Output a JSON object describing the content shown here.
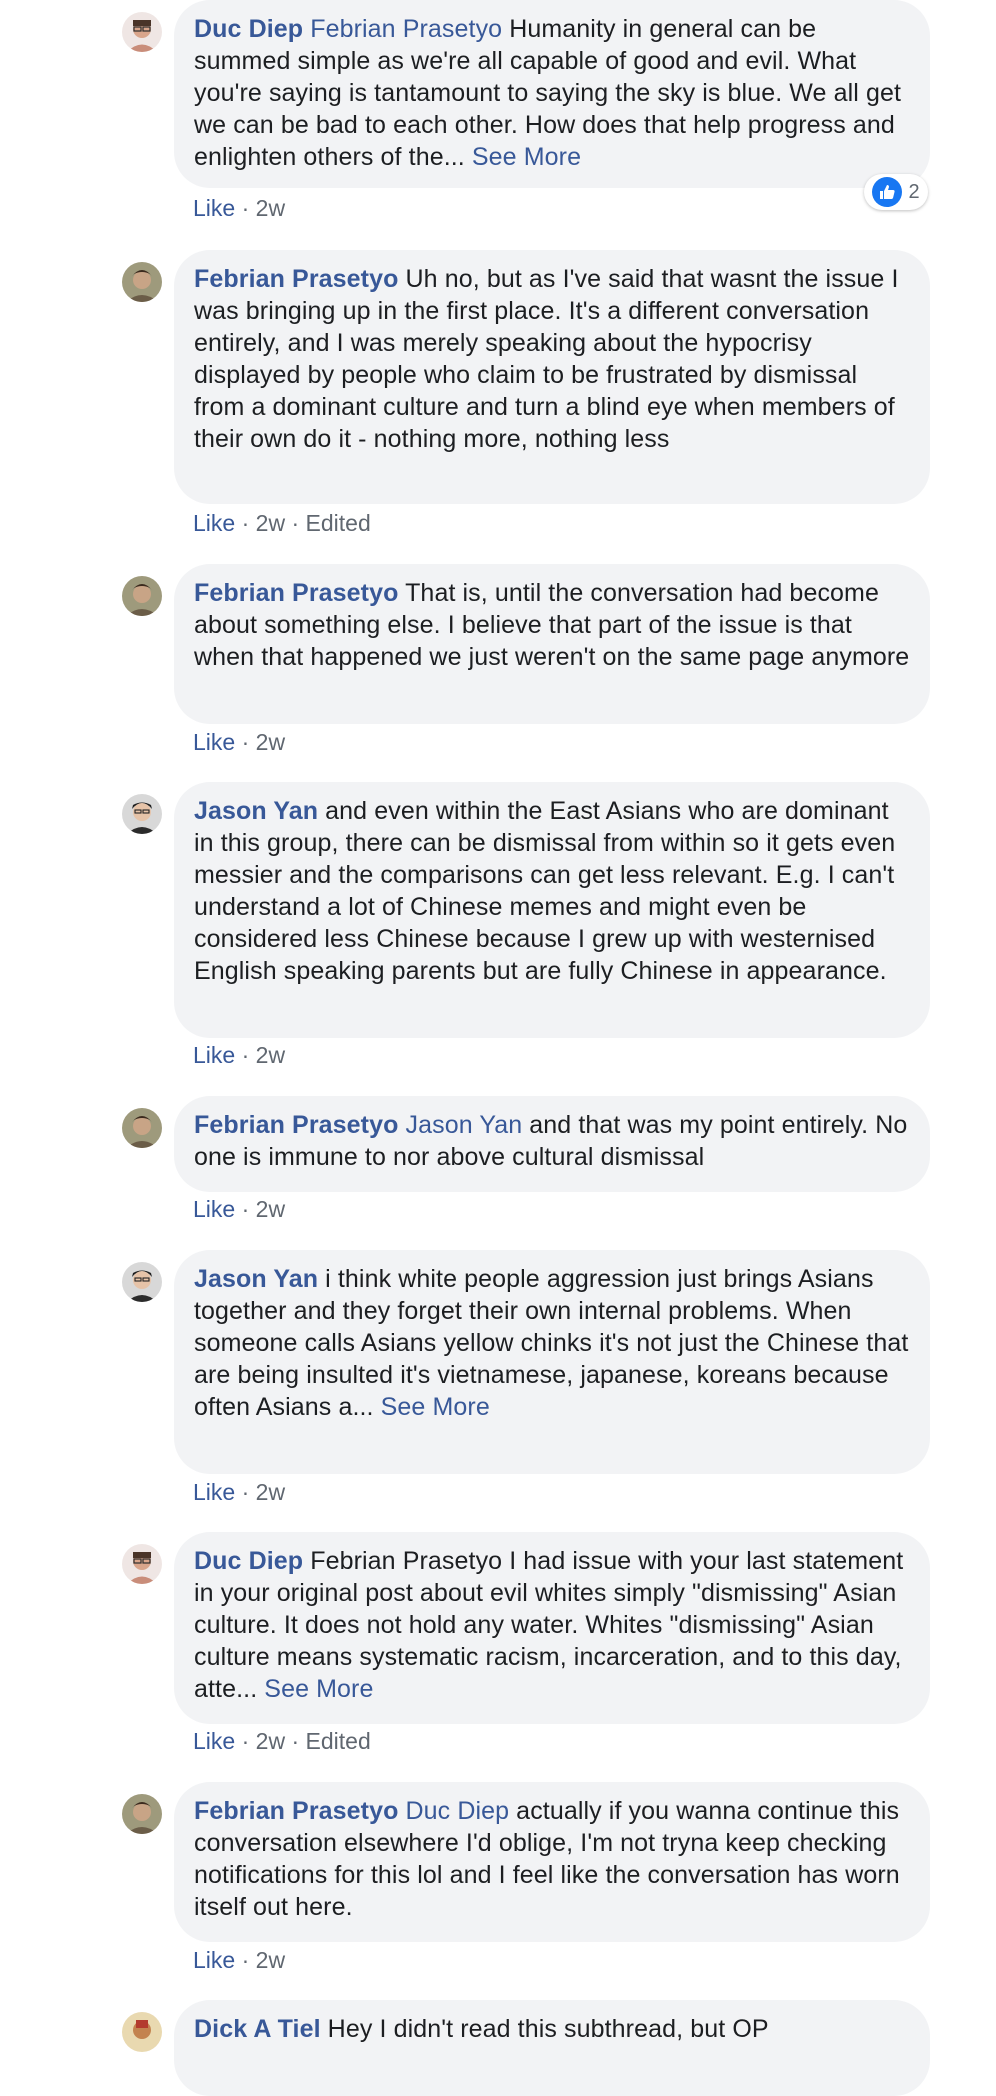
{
  "comments": [
    {
      "author": "Duc Diep",
      "mention": "Febrian Prasetyo",
      "text": " Humanity in general can be summed simple as we're all capable of good and evil. What you're saying is tantamount to saying the sky is blue. We all get we can be bad to each other. How does that help progress and enlighten others of the... ",
      "see_more": "See More",
      "like": "Like",
      "time": "2w",
      "reaction_count": "2"
    },
    {
      "author": "Febrian Prasetyo",
      "text": " Uh no, but as I've said that wasnt the issue I was bringing up in the first place. It's a different conversation entirely, and I was merely speaking about the hypocrisy displayed by people who claim to be frustrated by dismissal from a dominant culture and turn a blind eye when members of their own do it - nothing more, nothing less",
      "like": "Like",
      "time": "2w",
      "edited": "Edited"
    },
    {
      "author": "Febrian Prasetyo",
      "text": " That is, until the conversation had become about something else. I believe that part of the issue is that when that happened we just weren't on the same page anymore",
      "like": "Like",
      "time": "2w"
    },
    {
      "author": "Jason Yan",
      "text": " and even within the East Asians who are dominant in this group, there can be dismissal from within so it gets even messier and the comparisons can get less relevant. E.g. I can't understand a lot of Chinese memes and might even be considered less Chinese because I grew up with westernised English speaking parents but are fully Chinese in appearance.",
      "like": "Like",
      "time": "2w"
    },
    {
      "author": "Febrian Prasetyo",
      "mention": "Jason Yan",
      "text": " and that was my point entirely. No one is immune to nor above cultural dismissal",
      "like": "Like",
      "time": "2w"
    },
    {
      "author": "Jason Yan",
      "text": " i think white people aggression just brings Asians together and they forget their own internal problems. When someone calls Asians yellow chinks it's not just the Chinese that are being insulted it's vietnamese, japanese, koreans because often Asians a... ",
      "see_more": "See More",
      "like": "Like",
      "time": "2w"
    },
    {
      "author": "Duc Diep",
      "text": " Febrian Prasetyo I had issue with your last statement in your original post about evil whites simply \"dismissing\" Asian culture. It does not hold any water. Whites \"dismissing\" Asian culture means systematic racism, incarceration, and to this day, atte... ",
      "see_more": "See More",
      "like": "Like",
      "time": "2w",
      "edited": "Edited"
    },
    {
      "author": "Febrian Prasetyo",
      "mention": "Duc Diep",
      "text": " actually if you wanna continue this conversation elsewhere I'd oblige, I'm not tryna keep checking notifications for this lol and I feel like the conversation has worn itself out here.",
      "like": "Like",
      "time": "2w"
    },
    {
      "author": "Dick A Tiel",
      "text": " Hey I didn't read this subthread, but OP"
    }
  ],
  "separator": " · ",
  "colors": {
    "link": "#385898",
    "bubble": "#f2f3f5",
    "meta": "#606770",
    "like_reaction": "#1877f2"
  },
  "icons": {
    "reaction": "like-reaction-icon",
    "avatar_duc": "avatar-duc-diep",
    "avatar_febrian": "avatar-febrian-prasetyo",
    "avatar_jason": "avatar-jason-yan",
    "avatar_dick": "avatar-dick-a-tiel"
  }
}
